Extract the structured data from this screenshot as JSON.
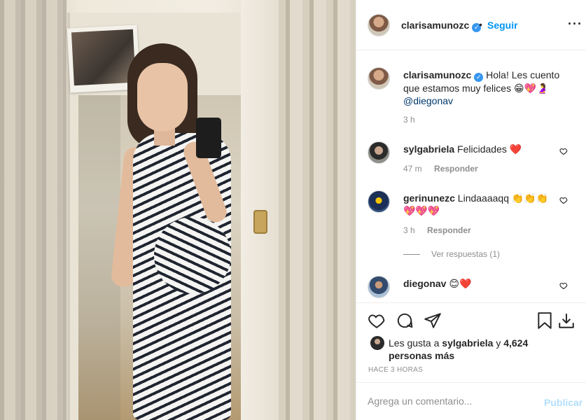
{
  "post": {
    "author": "clarisamunozc",
    "verified_mark": "✓",
    "dot": "•",
    "follow_label": "Seguir",
    "more_label": "···",
    "photo_alt": "Foto de clarisamunozc"
  },
  "caption": {
    "author": "clarisamunozc",
    "text": "Hola! Les cuento que estamos muy felices 😁💖🤰",
    "mention": "@diegonav",
    "time": "3 h"
  },
  "comments": [
    {
      "user": "sylgabriela",
      "text": "Felicidades ❤️",
      "time": "47 m",
      "reply": "Responder"
    },
    {
      "user": "gerinunezc",
      "text": "Lindaaaaqq 👏👏👏",
      "text2": "💖💖💖",
      "time": "3 h",
      "reply": "Responder"
    },
    {
      "user": "diegonav",
      "text": "😊❤️"
    }
  ],
  "view_replies": "Ver respuestas (1)",
  "icons": {
    "like": "heart-icon",
    "comment": "comment-icon",
    "share": "share-icon",
    "save": "bookmark-icon",
    "download": "download-icon",
    "comment_like": "small-heart-icon"
  },
  "likes": {
    "prefix": "Les gusta a",
    "user": "sylgabriela",
    "middle": "y",
    "count": "4,624 personas más"
  },
  "posted": "HACE 3 HORAS",
  "add_comment": {
    "placeholder": "Agrega un comentario...",
    "publish": "Publicar"
  },
  "colors": {
    "accent": "#0095f6",
    "publish_disabled": "#b2dffc",
    "verified": "#3897f0"
  }
}
